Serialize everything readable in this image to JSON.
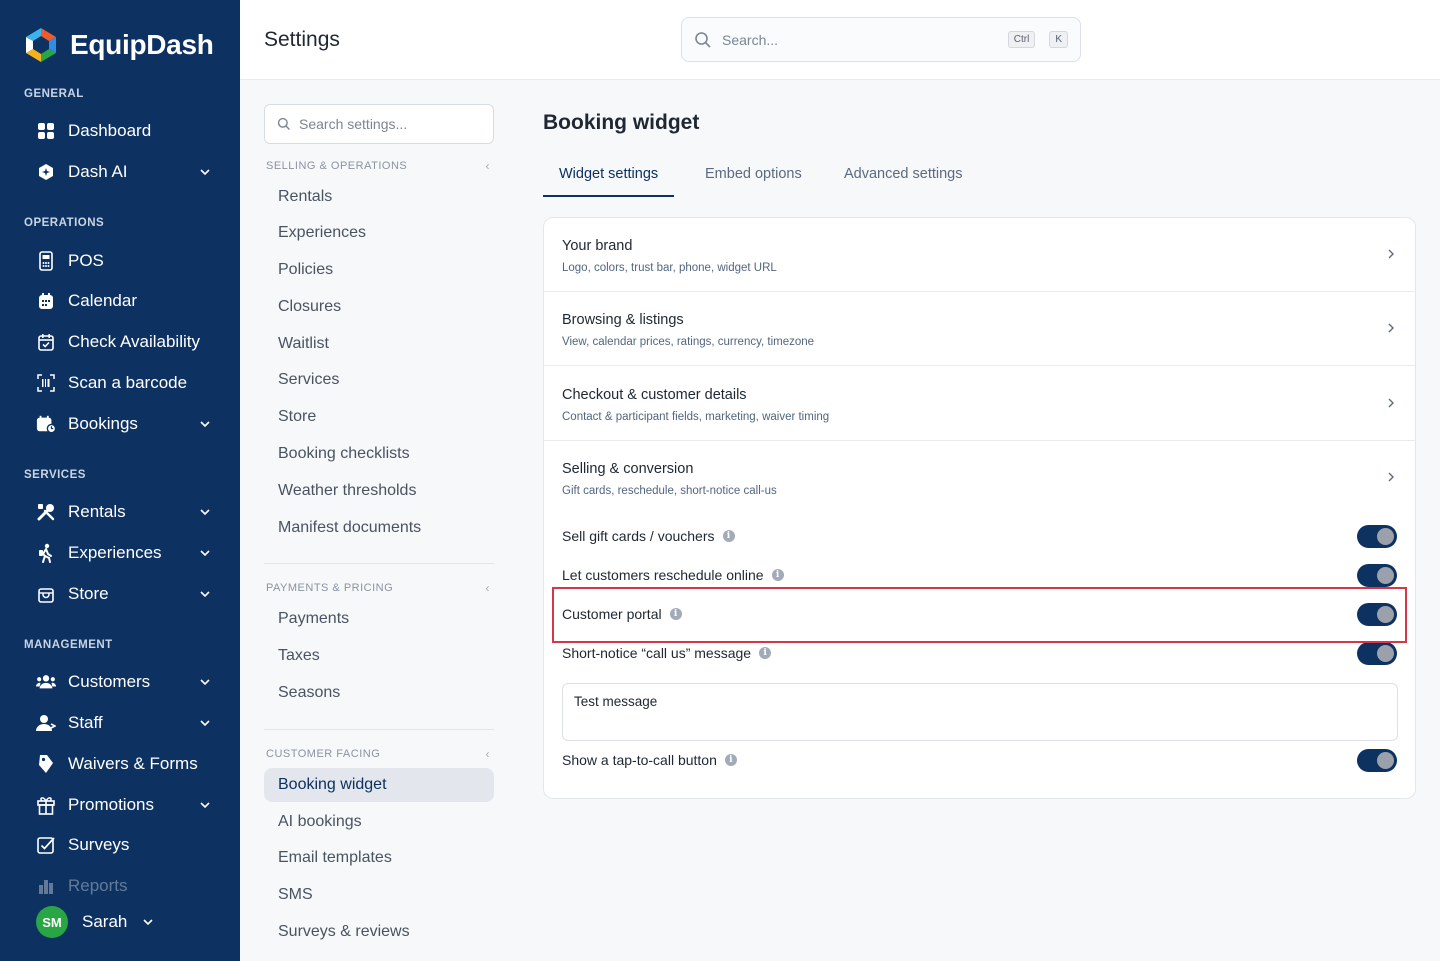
{
  "app": {
    "name": "EquipDash"
  },
  "topbar": {
    "title": "Settings",
    "search_placeholder": "Search...",
    "kbd_ctrl": "Ctrl",
    "kbd_k": "K"
  },
  "sidebar": {
    "sections": {
      "general": "GENERAL",
      "operations": "OPERATIONS",
      "services": "SERVICES",
      "management": "MANAGEMENT"
    },
    "items": {
      "dashboard": "Dashboard",
      "dash_ai": "Dash AI",
      "pos": "POS",
      "calendar": "Calendar",
      "check_availability": "Check Availability",
      "scan_barcode": "Scan a barcode",
      "bookings": "Bookings",
      "rentals": "Rentals",
      "experiences": "Experiences",
      "store": "Store",
      "customers": "Customers",
      "staff": "Staff",
      "waivers": "Waivers & Forms",
      "promotions": "Promotions",
      "surveys": "Surveys",
      "reports": "Reports"
    },
    "user": {
      "initials": "SM",
      "name": "Sarah"
    }
  },
  "settings_nav": {
    "search_placeholder": "Search settings...",
    "groups": {
      "selling": {
        "title": "SELLING & OPERATIONS",
        "items": [
          "Rentals",
          "Experiences",
          "Policies",
          "Closures",
          "Waitlist",
          "Services",
          "Store",
          "Booking checklists",
          "Weather thresholds",
          "Manifest documents"
        ]
      },
      "payments": {
        "title": "PAYMENTS & PRICING",
        "items": [
          "Payments",
          "Taxes",
          "Seasons"
        ]
      },
      "customer": {
        "title": "CUSTOMER FACING",
        "items": [
          "Booking widget",
          "AI bookings",
          "Email templates",
          "SMS",
          "Surveys & reviews"
        ]
      }
    }
  },
  "main": {
    "title": "Booking widget",
    "tabs": [
      "Widget settings",
      "Embed options",
      "Advanced settings"
    ],
    "active_tab": "Widget settings",
    "sections": [
      {
        "title": "Your brand",
        "subtitle": "Logo, colors, trust bar, phone, widget URL"
      },
      {
        "title": "Browsing & listings",
        "subtitle": "View, calendar prices, ratings, currency, timezone"
      },
      {
        "title": "Checkout & customer details",
        "subtitle": "Contact & participant fields, marketing, waiver timing"
      },
      {
        "title": "Selling & conversion",
        "subtitle": "Gift cards, reschedule, short-notice call-us"
      }
    ],
    "toggles": [
      {
        "label": "Sell gift cards / vouchers",
        "on": true
      },
      {
        "label": "Let customers reschedule online",
        "on": true
      },
      {
        "label": "Customer portal",
        "on": true
      },
      {
        "label": "Short-notice “call us” message",
        "on": true
      },
      {
        "label": "Show a tap-to-call button",
        "on": true
      }
    ],
    "message_value": "Test message"
  },
  "colors": {
    "sidebar_bg": "#0d3160",
    "accent": "#0d3160",
    "highlight": "#d6354a",
    "avatar": "#29a644"
  }
}
